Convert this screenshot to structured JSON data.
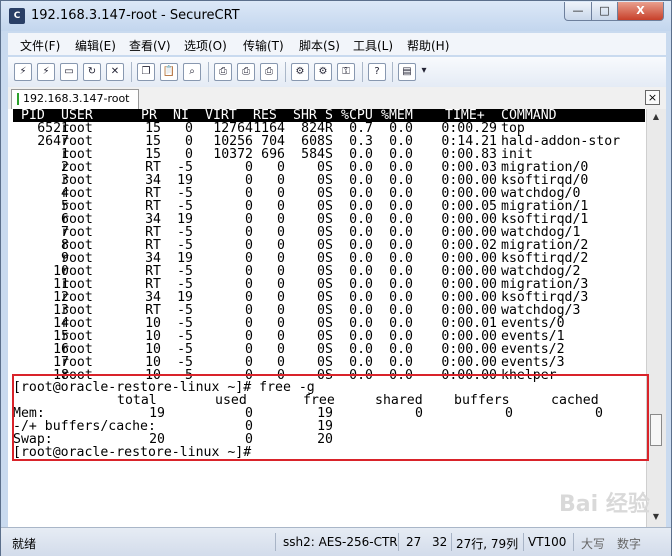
{
  "window": {
    "title": "192.168.3.147-root - SecureCRT",
    "app_icon": "securecrt-icon",
    "min_icon": "minimize-icon",
    "max_icon": "maximize-icon",
    "close_icon": "close-icon",
    "min_glyph": "—",
    "max_glyph": "□",
    "close_glyph": "X"
  },
  "menu": [
    "文件(F)",
    "编辑(E)",
    "查看(V)",
    "选项(O)",
    "传输(T)",
    "脚本(S)",
    "工具(L)",
    "帮助(H)"
  ],
  "toolbar": {
    "icons": [
      "connect-icon",
      "quick-connect-icon",
      "connect-in-tab-icon",
      "reconnect-icon",
      "disconnect-icon",
      "copy-icon",
      "paste-icon",
      "find-icon",
      "print-icon",
      "print-selection-icon",
      "print-setup-icon",
      "session-options-icon",
      "global-options-icon",
      "keymap-icon",
      "help-icon",
      "sftp-icon",
      "toolbar-overflow-icon"
    ]
  },
  "tabs": [
    {
      "label": "192.168.3.147-root",
      "status_color": "#2ca02c"
    }
  ],
  "terminal": {
    "columns": [
      "PID",
      "USER",
      "PR",
      "NI",
      "VIRT",
      "RES",
      "SHR",
      "S",
      "%CPU",
      "%MEM",
      "TIME+",
      "COMMAND"
    ],
    "rows": [
      [
        "6521",
        "root",
        "15",
        "0",
        "12764",
        "1164",
        "824",
        "R",
        "0.7",
        "0.0",
        "0:00.29",
        "top"
      ],
      [
        "2647",
        "root",
        "15",
        "0",
        "10256",
        "704",
        "608",
        "S",
        "0.3",
        "0.0",
        "0:14.21",
        "hald-addon-stor"
      ],
      [
        "1",
        "root",
        "15",
        "0",
        "10372",
        "696",
        "584",
        "S",
        "0.0",
        "0.0",
        "0:00.83",
        "init"
      ],
      [
        "2",
        "root",
        "RT",
        "-5",
        "0",
        "0",
        "0",
        "S",
        "0.0",
        "0.0",
        "0:00.03",
        "migration/0"
      ],
      [
        "3",
        "root",
        "34",
        "19",
        "0",
        "0",
        "0",
        "S",
        "0.0",
        "0.0",
        "0:00.00",
        "ksoftirqd/0"
      ],
      [
        "4",
        "root",
        "RT",
        "-5",
        "0",
        "0",
        "0",
        "S",
        "0.0",
        "0.0",
        "0:00.00",
        "watchdog/0"
      ],
      [
        "5",
        "root",
        "RT",
        "-5",
        "0",
        "0",
        "0",
        "S",
        "0.0",
        "0.0",
        "0:00.05",
        "migration/1"
      ],
      [
        "6",
        "root",
        "34",
        "19",
        "0",
        "0",
        "0",
        "S",
        "0.0",
        "0.0",
        "0:00.00",
        "ksoftirqd/1"
      ],
      [
        "7",
        "root",
        "RT",
        "-5",
        "0",
        "0",
        "0",
        "S",
        "0.0",
        "0.0",
        "0:00.00",
        "watchdog/1"
      ],
      [
        "8",
        "root",
        "RT",
        "-5",
        "0",
        "0",
        "0",
        "S",
        "0.0",
        "0.0",
        "0:00.02",
        "migration/2"
      ],
      [
        "9",
        "root",
        "34",
        "19",
        "0",
        "0",
        "0",
        "S",
        "0.0",
        "0.0",
        "0:00.00",
        "ksoftirqd/2"
      ],
      [
        "10",
        "root",
        "RT",
        "-5",
        "0",
        "0",
        "0",
        "S",
        "0.0",
        "0.0",
        "0:00.00",
        "watchdog/2"
      ],
      [
        "11",
        "root",
        "RT",
        "-5",
        "0",
        "0",
        "0",
        "S",
        "0.0",
        "0.0",
        "0:00.00",
        "migration/3"
      ],
      [
        "12",
        "root",
        "34",
        "19",
        "0",
        "0",
        "0",
        "S",
        "0.0",
        "0.0",
        "0:00.00",
        "ksoftirqd/3"
      ],
      [
        "13",
        "root",
        "RT",
        "-5",
        "0",
        "0",
        "0",
        "S",
        "0.0",
        "0.0",
        "0:00.00",
        "watchdog/3"
      ],
      [
        "14",
        "root",
        "10",
        "-5",
        "0",
        "0",
        "0",
        "S",
        "0.0",
        "0.0",
        "0:00.01",
        "events/0"
      ],
      [
        "15",
        "root",
        "10",
        "-5",
        "0",
        "0",
        "0",
        "S",
        "0.0",
        "0.0",
        "0:00.00",
        "events/1"
      ],
      [
        "16",
        "root",
        "10",
        "-5",
        "0",
        "0",
        "0",
        "S",
        "0.0",
        "0.0",
        "0:00.00",
        "events/2"
      ],
      [
        "17",
        "root",
        "10",
        "-5",
        "0",
        "0",
        "0",
        "S",
        "0.0",
        "0.0",
        "0:00.00",
        "events/3"
      ],
      [
        "18",
        "root",
        "10",
        "-5",
        "0",
        "0",
        "0",
        "S",
        "0.0",
        "0.0",
        "0:00.00",
        "khelper"
      ]
    ],
    "prompt_command": "[root@oracle-restore-linux ~]# free -g",
    "free_header": [
      "total",
      "used",
      "free",
      "shared",
      "buffers",
      "cached"
    ],
    "free_rows": [
      [
        "Mem:",
        "19",
        "0",
        "19",
        "0",
        "0",
        "0"
      ],
      [
        "-/+ buffers/cache:",
        "",
        "0",
        "19",
        "",
        "",
        ""
      ],
      [
        "Swap:",
        "20",
        "0",
        "20",
        "",
        "",
        ""
      ]
    ],
    "prompt_idle": "[root@oracle-restore-linux ~]#",
    "highlight_color": "#d9232a"
  },
  "statusbar": {
    "ready": "就绪",
    "cipher": "ssh2: AES-256-CTR",
    "cursor_row": "27",
    "cursor_col": "32",
    "dimensions": "27行, 79列",
    "terminal_type": "VT100",
    "caps": "大写",
    "num": "数字"
  },
  "watermark": "Bai 经验"
}
